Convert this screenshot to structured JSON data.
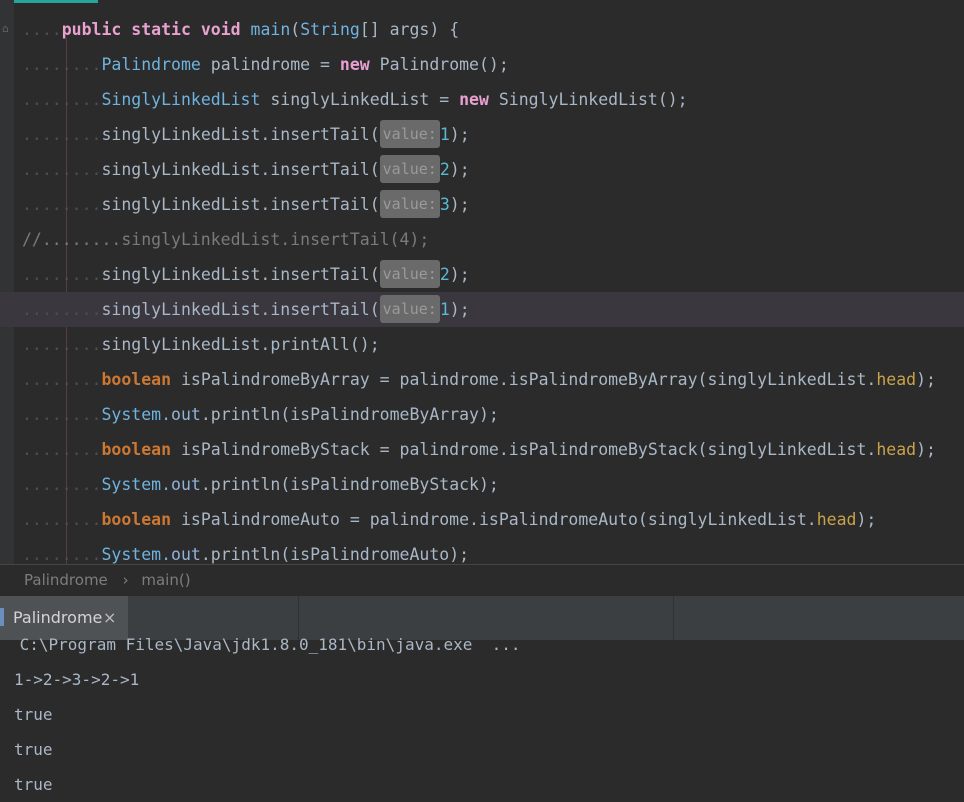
{
  "code": [
    {
      "segs": [
        {
          "t": "....",
          "c": "dots"
        },
        {
          "t": "public ",
          "c": "kw2"
        },
        {
          "t": "static ",
          "c": "kw2"
        },
        {
          "t": "void ",
          "c": "kw2"
        },
        {
          "t": "main",
          "c": "cls"
        },
        {
          "t": "(",
          "c": "fn"
        },
        {
          "t": "String",
          "c": "cls"
        },
        {
          "t": "[] args) {",
          "c": "fn"
        }
      ]
    },
    {
      "segs": [
        {
          "t": "........",
          "c": "dots"
        },
        {
          "t": "Palindrome",
          "c": "cls"
        },
        {
          "t": " palindrome = ",
          "c": "fn"
        },
        {
          "t": "new ",
          "c": "kw2"
        },
        {
          "t": "Palindrome();",
          "c": "fn"
        }
      ]
    },
    {
      "segs": [
        {
          "t": "........",
          "c": "dots"
        },
        {
          "t": "SinglyLinkedList",
          "c": "cls"
        },
        {
          "t": " singlyLinkedList = ",
          "c": "fn"
        },
        {
          "t": "new ",
          "c": "kw2"
        },
        {
          "t": "SinglyLinkedList();",
          "c": "fn"
        }
      ]
    },
    {
      "segs": [
        {
          "t": "........",
          "c": "dots"
        },
        {
          "t": "singlyLinkedList.insertTail(",
          "c": "fn"
        },
        {
          "t": "value:",
          "c": "hint"
        },
        {
          "t": "1",
          "c": "num"
        },
        {
          "t": ");",
          "c": "fn"
        }
      ]
    },
    {
      "segs": [
        {
          "t": "........",
          "c": "dots"
        },
        {
          "t": "singlyLinkedList.insertTail(",
          "c": "fn"
        },
        {
          "t": "value:",
          "c": "hint"
        },
        {
          "t": "2",
          "c": "num"
        },
        {
          "t": ");",
          "c": "fn"
        }
      ]
    },
    {
      "segs": [
        {
          "t": "........",
          "c": "dots"
        },
        {
          "t": "singlyLinkedList.insertTail(",
          "c": "fn"
        },
        {
          "t": "value:",
          "c": "hint"
        },
        {
          "t": "3",
          "c": "num"
        },
        {
          "t": ");",
          "c": "fn"
        }
      ]
    },
    {
      "segs": [
        {
          "t": "//........singlyLinkedList.insertTail(4);",
          "c": "comment"
        }
      ]
    },
    {
      "segs": [
        {
          "t": "........",
          "c": "dots"
        },
        {
          "t": "singlyLinkedList.insertTail(",
          "c": "fn"
        },
        {
          "t": "value:",
          "c": "hint"
        },
        {
          "t": "2",
          "c": "num"
        },
        {
          "t": ");",
          "c": "fn"
        }
      ]
    },
    {
      "current": true,
      "segs": [
        {
          "t": "........",
          "c": "dots"
        },
        {
          "t": "singlyLinkedList.insertTail(",
          "c": "fn"
        },
        {
          "t": "value:",
          "c": "hint"
        },
        {
          "t": "1",
          "c": "num"
        },
        {
          "t": ");",
          "c": "fn"
        }
      ]
    },
    {
      "segs": [
        {
          "t": "........",
          "c": "dots"
        },
        {
          "t": "singlyLinkedList.printAll();",
          "c": "fn"
        }
      ]
    },
    {
      "segs": [
        {
          "t": "........",
          "c": "dots"
        },
        {
          "t": "boolean ",
          "c": "kw"
        },
        {
          "t": "isPalindromeByArray = palindrome.isPalindromeByArray(singlyLinkedList.",
          "c": "fn"
        },
        {
          "t": "head",
          "c": "fld"
        },
        {
          "t": ");",
          "c": "fn"
        }
      ]
    },
    {
      "segs": [
        {
          "t": "........",
          "c": "dots"
        },
        {
          "t": "System.",
          "c": "cls"
        },
        {
          "t": "out",
          "c": "out"
        },
        {
          "t": ".println(isPalindromeByArray);",
          "c": "fn"
        }
      ]
    },
    {
      "segs": [
        {
          "t": "........",
          "c": "dots"
        },
        {
          "t": "boolean ",
          "c": "kw"
        },
        {
          "t": "isPalindromeByStack = palindrome.isPalindromeByStack(singlyLinkedList.",
          "c": "fn"
        },
        {
          "t": "head",
          "c": "fld"
        },
        {
          "t": ");",
          "c": "fn"
        }
      ]
    },
    {
      "segs": [
        {
          "t": "........",
          "c": "dots"
        },
        {
          "t": "System.",
          "c": "cls"
        },
        {
          "t": "out",
          "c": "out"
        },
        {
          "t": ".println(isPalindromeByStack);",
          "c": "fn"
        }
      ]
    },
    {
      "segs": [
        {
          "t": "........",
          "c": "dots"
        },
        {
          "t": "boolean ",
          "c": "kw"
        },
        {
          "t": "isPalindromeAuto = palindrome.isPalindromeAuto(singlyLinkedList.",
          "c": "fn"
        },
        {
          "t": "head",
          "c": "fld"
        },
        {
          "t": ");",
          "c": "fn"
        }
      ]
    },
    {
      "segs": [
        {
          "t": "........",
          "c": "dots"
        },
        {
          "t": "System.",
          "c": "cls"
        },
        {
          "t": "out",
          "c": "out"
        },
        {
          "t": ".println(isPalindromeAuto);",
          "c": "fn"
        }
      ]
    }
  ],
  "breadcrumb": {
    "class_name": "Palindrome",
    "separator": "›",
    "method": "main()"
  },
  "run_tab": {
    "label": "Palindrome",
    "close": "×"
  },
  "console": [
    " C:\\Program Files\\Java\\jdk1.8.0_181\\bin\\java.exe  ...",
    "1->2->3->2->1",
    "true",
    "true",
    "true"
  ]
}
